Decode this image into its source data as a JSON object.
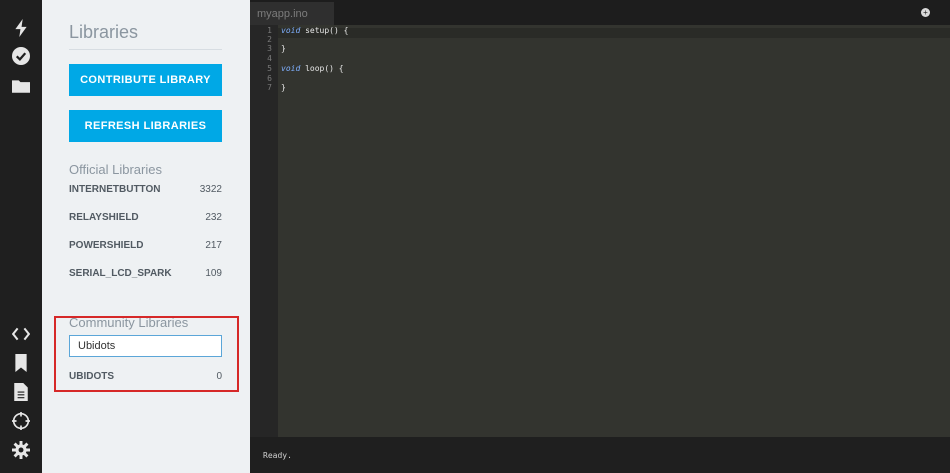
{
  "rail": {
    "icons": [
      "flash-icon",
      "verify-icon",
      "folder-icon",
      "code-icon",
      "bookmark-icon",
      "document-icon",
      "crosshair-icon",
      "gear-icon"
    ]
  },
  "libraries": {
    "title": "Libraries",
    "contribute_label": "CONTRIBUTE LIBRARY",
    "refresh_label": "REFRESH LIBRARIES",
    "official_title": "Official Libraries",
    "official": [
      {
        "name": "INTERNETBUTTON",
        "count": "3322"
      },
      {
        "name": "RELAYSHIELD",
        "count": "232"
      },
      {
        "name": "POWERSHIELD",
        "count": "217"
      },
      {
        "name": "SERIAL_LCD_SPARK",
        "count": "109"
      }
    ],
    "community_title": "Community Libraries",
    "search_value": "Ubidots",
    "community": [
      {
        "name": "UBIDOTS",
        "count": "0"
      }
    ]
  },
  "editor": {
    "tab_name": "myapp.ino",
    "line_numbers": [
      "1",
      "2",
      "3",
      "4",
      "5",
      "6",
      "7"
    ],
    "lines": [
      {
        "kw": "void",
        "rest": " setup() {"
      },
      {
        "kw": "",
        "rest": ""
      },
      {
        "kw": "",
        "rest": "}"
      },
      {
        "kw": "",
        "rest": ""
      },
      {
        "kw": "void",
        "rest": " loop() {"
      },
      {
        "kw": "",
        "rest": ""
      },
      {
        "kw": "",
        "rest": "}"
      }
    ],
    "console_text": "Ready."
  },
  "colors": {
    "accent": "#00a8e6",
    "highlight": "#d62828"
  }
}
